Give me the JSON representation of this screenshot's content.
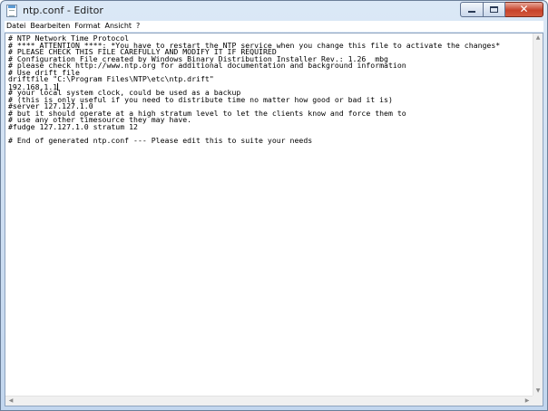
{
  "window": {
    "title": "ntp.conf - Editor",
    "icon": "notepad-icon"
  },
  "menu": {
    "items": [
      "Datei",
      "Bearbeiten",
      "Format",
      "Ansicht",
      "?"
    ]
  },
  "editor": {
    "lines": [
      "# NTP Network Time Protocol",
      "# **** ATTENTION ****: *You have to restart the NTP service when you change this file to activate the changes*",
      "# PLEASE CHECK THIS FILE CAREFULLY AND MODIFY IT IF REQUIRED",
      "# Configuration File created by Windows Binary Distribution Installer Rev.: 1.26  mbg",
      "# please check http://www.ntp.org for additional documentation and background information",
      "# Use drift file",
      "driftfile \"C:\\Program Files\\NTP\\etc\\ntp.drift\"",
      "192.168.1.1",
      "# your local system clock, could be used as a backup",
      "# (this is only useful if you need to distribute time no matter how good or bad it is)",
      "#server 127.127.1.0",
      "# but it should operate at a high stratum level to let the clients know and force them to",
      "# use any other timesource they may have.",
      "#fudge 127.127.1.0 stratum 12",
      "",
      "# End of generated ntp.conf --- Please edit this to suite your needs"
    ],
    "caret_line": 7
  },
  "scrollbars": {
    "up": "▲",
    "down": "▼",
    "left": "◀",
    "right": "▶"
  },
  "window_buttons": {
    "close": "✕"
  },
  "colors": {
    "close_button": "#c7432b",
    "titlebar": "#dbe8f6"
  }
}
